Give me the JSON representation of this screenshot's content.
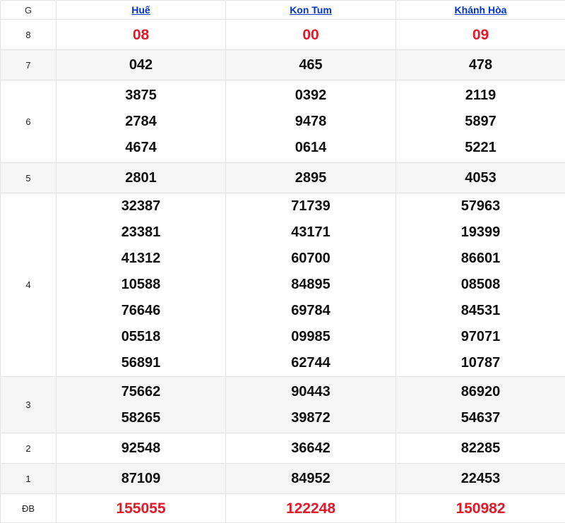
{
  "header": {
    "g_label": "G",
    "provinces": [
      "Huế",
      "Kon Tum",
      "Khánh Hòa"
    ]
  },
  "rows": [
    {
      "label": "8",
      "red": true,
      "values": [
        [
          "08"
        ],
        [
          "00"
        ],
        [
          "09"
        ]
      ]
    },
    {
      "label": "7",
      "red": false,
      "values": [
        [
          "042"
        ],
        [
          "465"
        ],
        [
          "478"
        ]
      ]
    },
    {
      "label": "6",
      "red": false,
      "values": [
        [
          "3875",
          "2784",
          "4674"
        ],
        [
          "0392",
          "9478",
          "0614"
        ],
        [
          "2119",
          "5897",
          "5221"
        ]
      ]
    },
    {
      "label": "5",
      "red": false,
      "values": [
        [
          "2801"
        ],
        [
          "2895"
        ],
        [
          "4053"
        ]
      ]
    },
    {
      "label": "4",
      "red": false,
      "values": [
        [
          "32387",
          "23381",
          "41312",
          "10588",
          "76646",
          "05518",
          "56891"
        ],
        [
          "71739",
          "43171",
          "60700",
          "84895",
          "69784",
          "09985",
          "62744"
        ],
        [
          "57963",
          "19399",
          "86601",
          "08508",
          "84531",
          "97071",
          "10787"
        ]
      ]
    },
    {
      "label": "3",
      "red": false,
      "values": [
        [
          "75662",
          "58265"
        ],
        [
          "90443",
          "39872"
        ],
        [
          "86920",
          "54637"
        ]
      ]
    },
    {
      "label": "2",
      "red": false,
      "values": [
        [
          "92548"
        ],
        [
          "36642"
        ],
        [
          "82285"
        ]
      ]
    },
    {
      "label": "1",
      "red": false,
      "values": [
        [
          "87109"
        ],
        [
          "84952"
        ],
        [
          "22453"
        ]
      ]
    },
    {
      "label": "ĐB",
      "red": true,
      "values": [
        [
          "155055"
        ],
        [
          "122248"
        ],
        [
          "150982"
        ]
      ]
    }
  ]
}
